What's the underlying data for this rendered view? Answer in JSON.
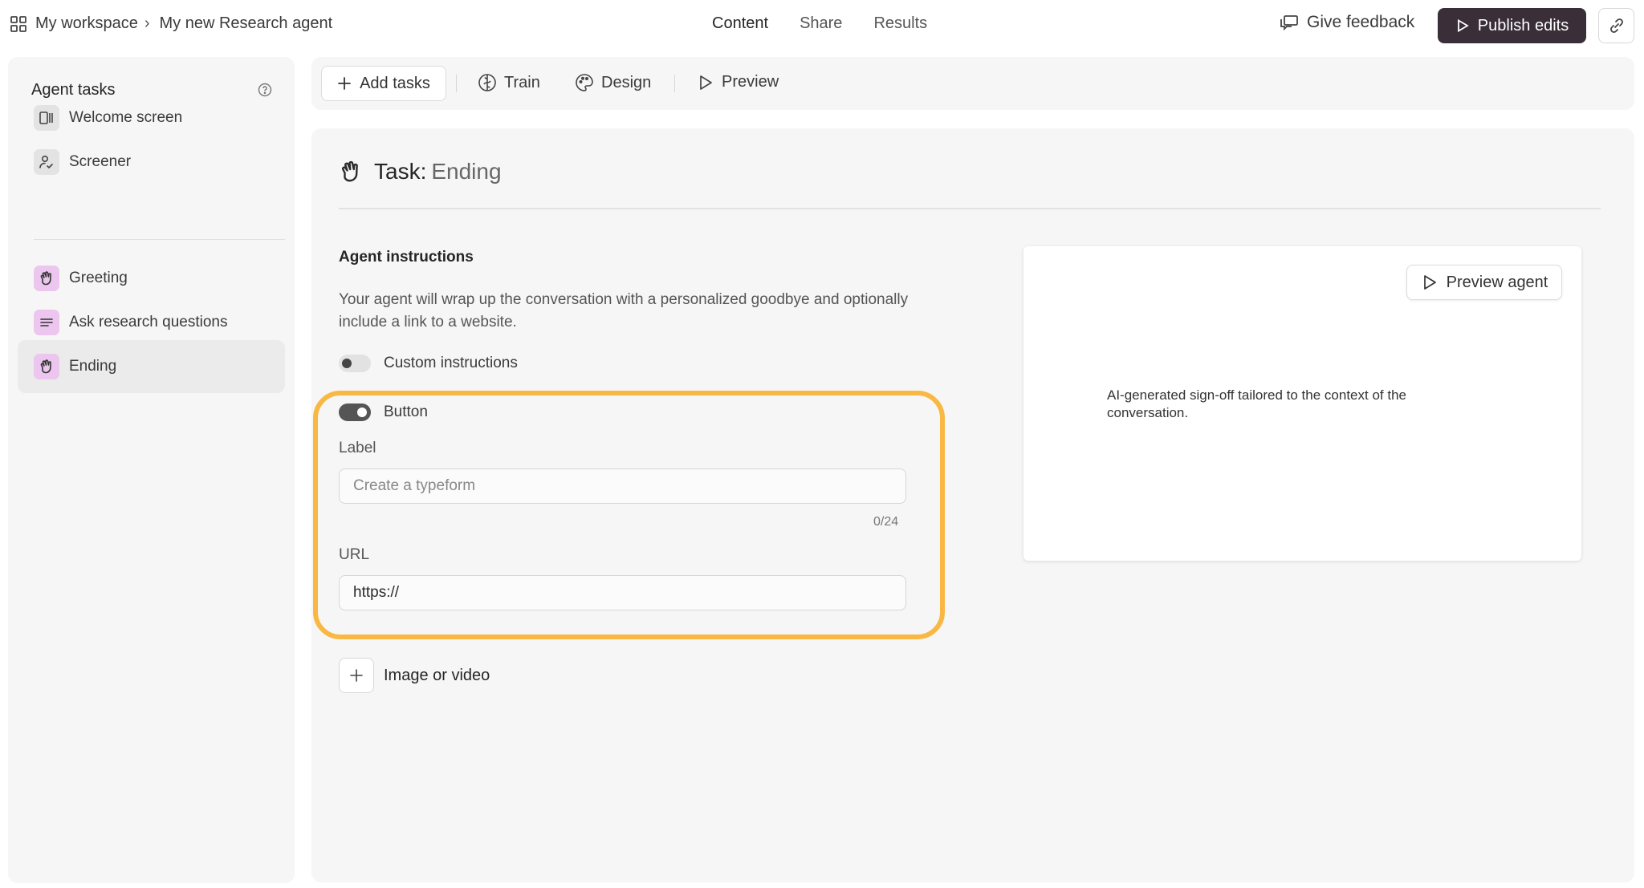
{
  "header": {
    "workspace": "My workspace",
    "project": "My new Research agent",
    "tabs": [
      {
        "label": "Content",
        "active": true
      },
      {
        "label": "Share",
        "active": false
      },
      {
        "label": "Results",
        "active": false
      }
    ],
    "feedback_label": "Give feedback",
    "publish_label": "Publish edits",
    "publish_color": "#3a2e38"
  },
  "sidebar": {
    "title": "Agent tasks",
    "items": [
      {
        "label": "Welcome screen",
        "icon": "welcome-screen-icon",
        "active": false
      },
      {
        "label": "Screener",
        "icon": "screener-icon",
        "active": false
      },
      {
        "label": "Greeting",
        "icon": "waving-hand-icon",
        "active": false
      },
      {
        "label": "Ask research questions",
        "icon": "text-lines-icon",
        "active": false
      },
      {
        "label": "Ending",
        "icon": "waving-hand-icon",
        "active": true
      }
    ],
    "accent_color": "#ecc6ef"
  },
  "toolbar": {
    "add_tasks": "Add tasks",
    "train": "Train",
    "design": "Design",
    "preview": "Preview"
  },
  "task": {
    "title_prefix": "Task:",
    "title_value": "Ending",
    "section_heading": "Agent instructions",
    "description": "Your agent will wrap up the conversation with a personalized goodbye and optionally include a link to a website.",
    "custom_instructions": {
      "label": "Custom instructions",
      "enabled": false
    },
    "button_toggle": {
      "label": "Button",
      "enabled": true
    },
    "label_field": {
      "label": "Label",
      "placeholder": "Create a typeform",
      "value": "",
      "counter": "0/24"
    },
    "url_field": {
      "label": "URL",
      "value": "https://"
    },
    "media_label": "Image or video",
    "highlight_color": "#f8b843"
  },
  "preview": {
    "button_label": "Preview agent",
    "text": "AI-generated sign-off tailored to the context of the conversation."
  }
}
